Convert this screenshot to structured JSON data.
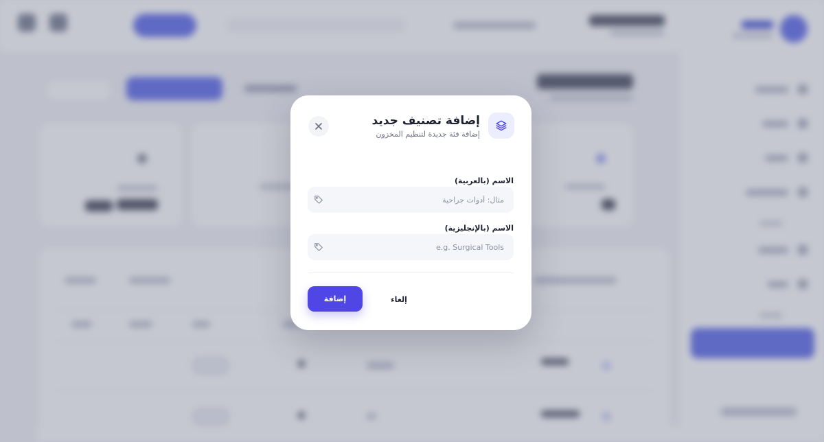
{
  "modal": {
    "title": "إضافة تصنيف جديد",
    "subtitle": "إضافة فئة جديدة لتنظيم المخزون",
    "icon": "layers-icon",
    "close_icon": "close-icon",
    "fields": [
      {
        "label": "الاسم (بالعربية)",
        "placeholder": "مثال: أدوات جراحية",
        "value": "",
        "icon": "tag-icon"
      },
      {
        "label": "الاسم (بالإنجليزية)",
        "placeholder": "e.g. Surgical Tools",
        "value": "",
        "icon": "tag-icon"
      }
    ],
    "buttons": {
      "submit": "إضافة",
      "cancel": "إلغاء"
    }
  },
  "colors": {
    "primary": "#4f46e5",
    "overlay": "rgba(118,124,146,0.42)",
    "icon_bg": "#ecedfd",
    "input_bg": "#f5f6f9",
    "text_dark": "#1d2130",
    "text_muted": "#6b7183"
  }
}
